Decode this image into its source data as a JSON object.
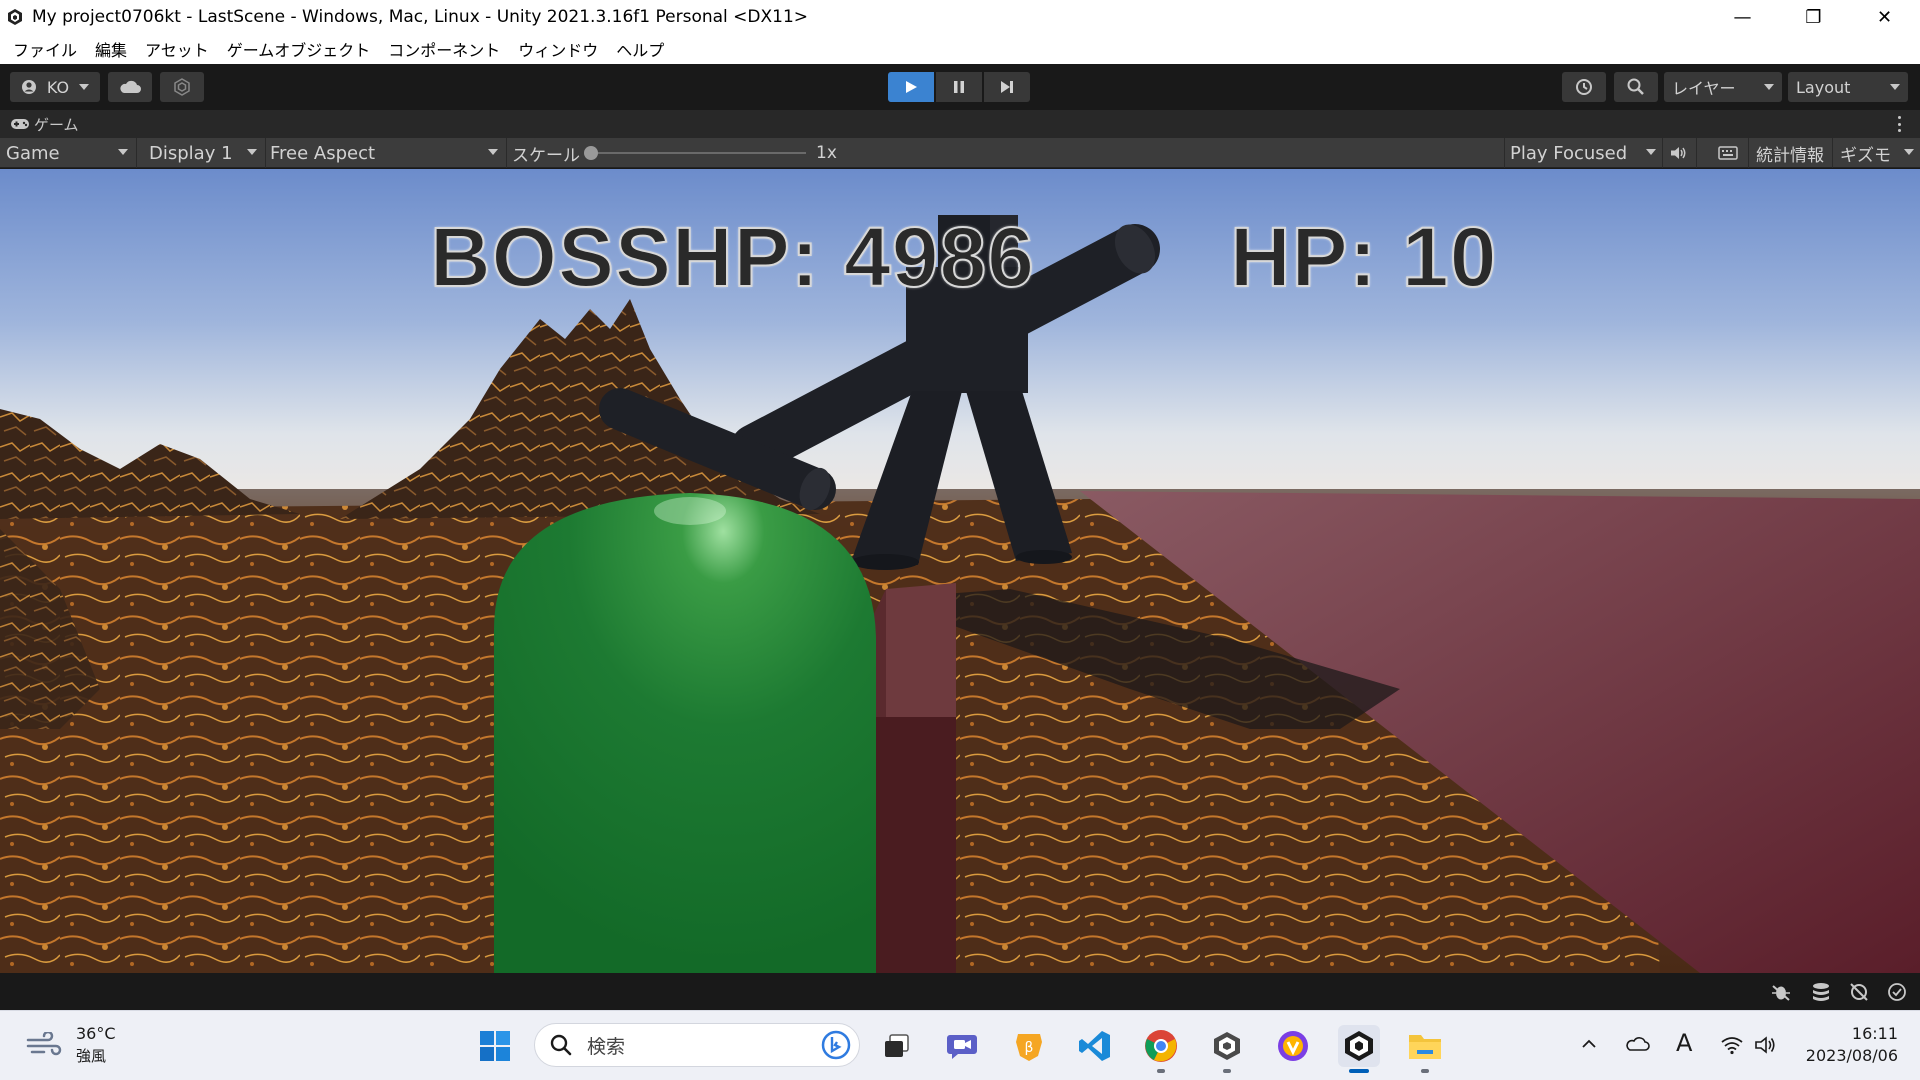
{
  "window": {
    "title": "My project0706kt - LastScene - Windows, Mac, Linux - Unity 2021.3.16f1 Personal <DX11>",
    "minimize": "—",
    "maximize": "❐",
    "close": "✕"
  },
  "menu": {
    "items": [
      "ファイル",
      "編集",
      "アセット",
      "ゲームオブジェクト",
      "コンポーネント",
      "ウィンドウ",
      "ヘルプ"
    ]
  },
  "toolbar": {
    "account": "KO",
    "layers": "レイヤー",
    "layout": "Layout",
    "play_state": "playing"
  },
  "tab": {
    "label": "ゲーム"
  },
  "gamebar": {
    "view_mode": "Game",
    "display": "Display 1",
    "aspect": "Free Aspect",
    "scale_label": "スケール",
    "scale_value": "1x",
    "scale_fraction": 0.0,
    "play_mode": "Play Focused",
    "stats": "統計情報",
    "gizmos": "ギズモ"
  },
  "hud": {
    "boss_hp": "BOSSHP: 4986",
    "player_hp": "HP: 10"
  },
  "taskbar": {
    "weather_temp": "36°C",
    "weather_cond": "強風",
    "search_placeholder": "検索",
    "apps": [
      "start-icon",
      "bing-icon",
      "task-view-icon",
      "meet-icon",
      "brave-icon",
      "vscode-icon",
      "chrome-icon",
      "unity-hub-icon",
      "vpn-icon",
      "unity-icon",
      "file-explorer-icon"
    ],
    "time": "16:11",
    "date": "2023/08/06",
    "ime": "A"
  },
  "colors": {
    "unity_dark": "#191919",
    "play_blue": "#3b83d1",
    "taskbar_bg": "#eef0f6",
    "sky_top": "#6e8fcd",
    "ground": "#5a3520",
    "player_green": "#1d7a32",
    "boss_body": "#1e2026",
    "floor_red": "#6b2c37"
  }
}
